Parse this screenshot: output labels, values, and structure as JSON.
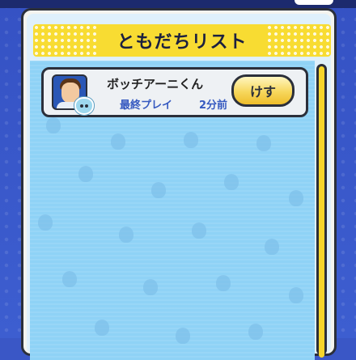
{
  "header": {
    "title": "ともだちリスト"
  },
  "friends": [
    {
      "name": "ボッチアーニくん",
      "last_play_label": "最終プレイ",
      "last_play_time": "2分前",
      "action_label": "けす"
    }
  ],
  "colors": {
    "background": "#3a57c6",
    "banner": "#f8dc32",
    "list_bg": "#8fd2f6",
    "row_bg": "#eef1f4",
    "accent_text": "#3559c0",
    "button": "#f7d75c"
  },
  "icons": {
    "avatar": "player-avatar-icon",
    "badge": "yokai-medal-icon"
  }
}
